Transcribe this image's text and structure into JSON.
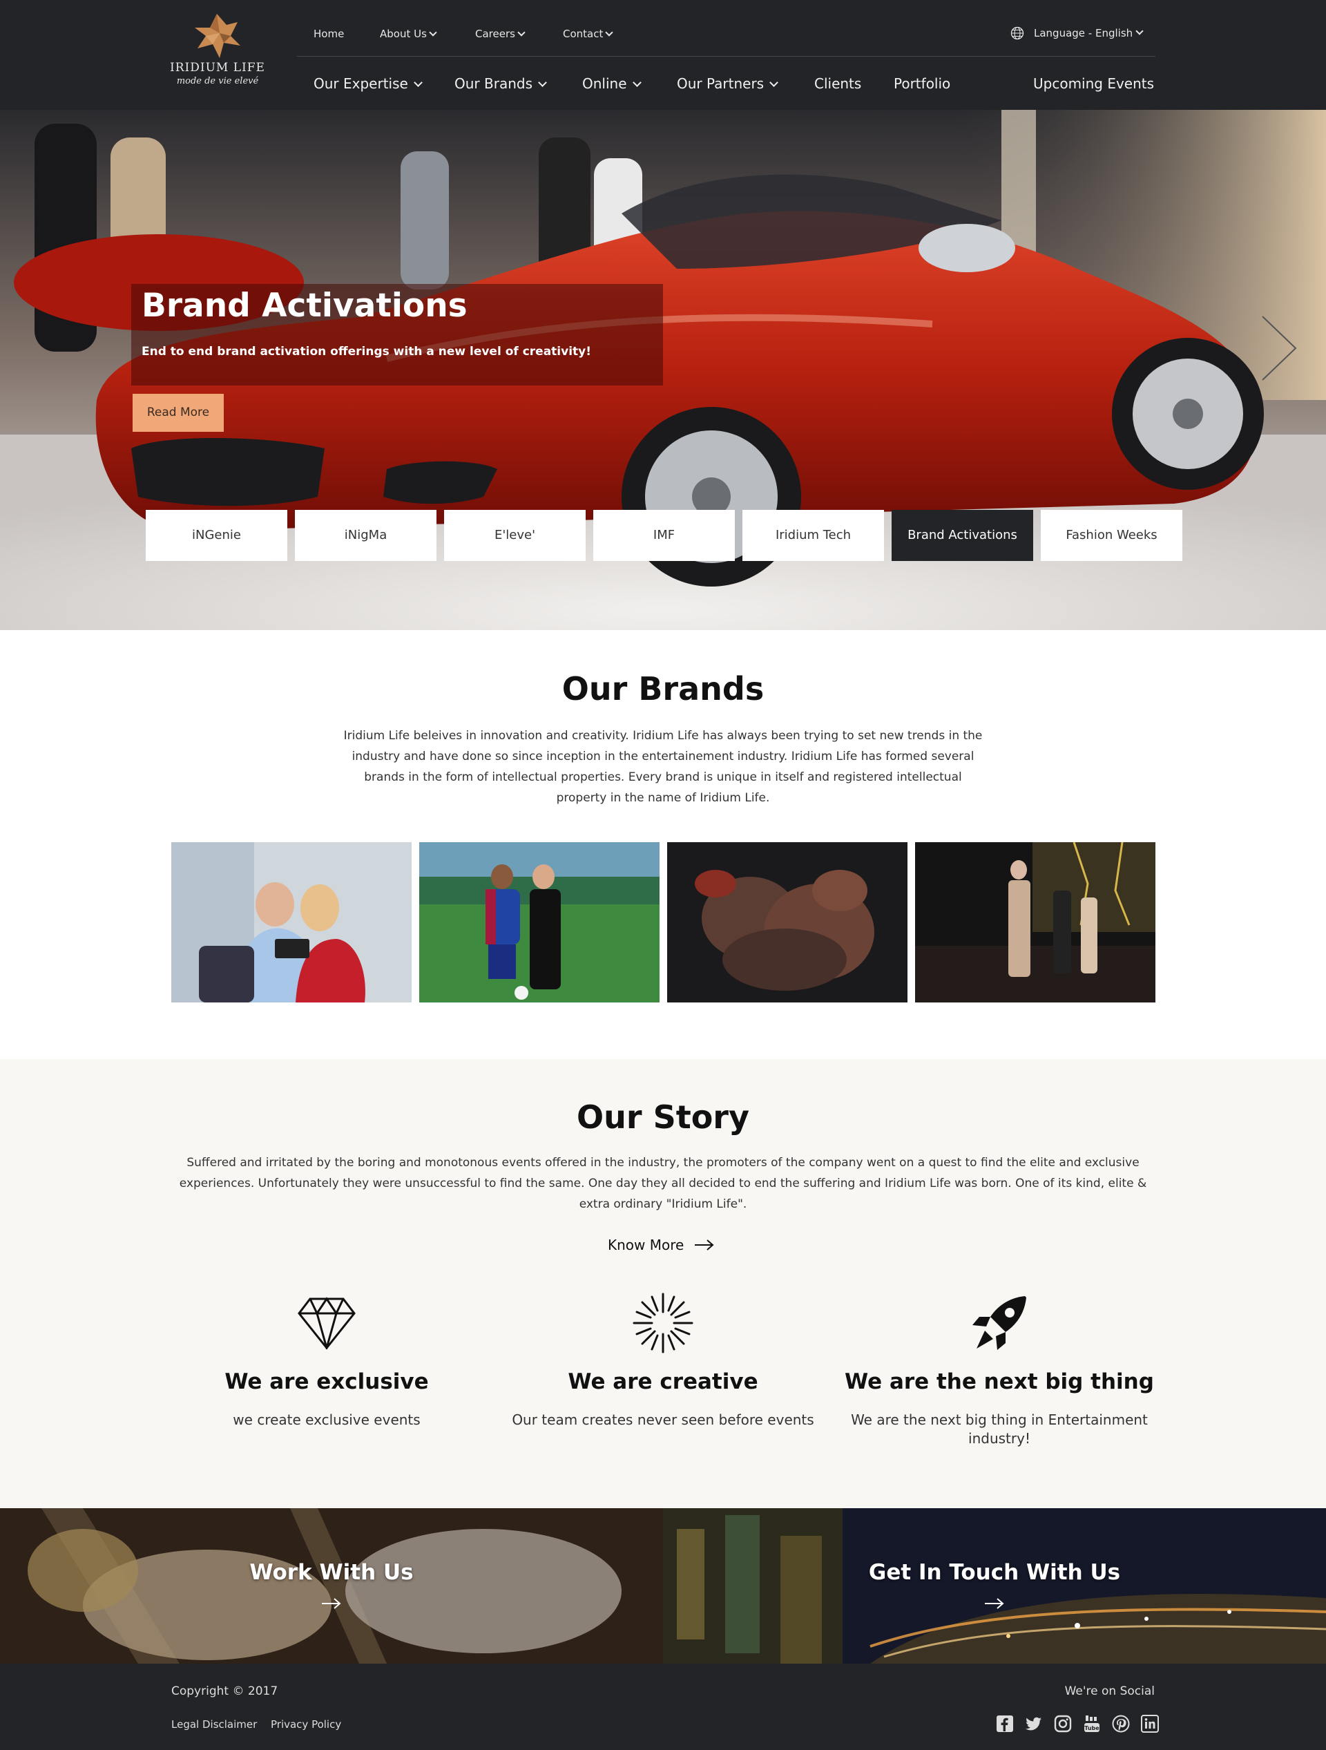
{
  "header": {
    "logo": {
      "name": "IRIDIUM LIFE",
      "tagline": "mode de vie elevé"
    },
    "top_nav": [
      {
        "label": "Home",
        "dropdown": false
      },
      {
        "label": "About Us",
        "dropdown": true
      },
      {
        "label": "Careers",
        "dropdown": true
      },
      {
        "label": "Contact",
        "dropdown": true
      }
    ],
    "language": "Language - English",
    "main_nav": [
      {
        "label": "Our Expertise",
        "dropdown": true
      },
      {
        "label": "Our Brands",
        "dropdown": true
      },
      {
        "label": "Online",
        "dropdown": true
      },
      {
        "label": "Our Partners",
        "dropdown": true
      },
      {
        "label": "Clients",
        "dropdown": false
      },
      {
        "label": "Portfolio",
        "dropdown": false
      },
      {
        "label": "Upcoming Events",
        "dropdown": false
      }
    ]
  },
  "hero": {
    "title": "Brand Activations",
    "subtitle": "End to end brand activation offerings with a new level of creativity!",
    "button": "Read More",
    "tabs": [
      "iNGenie",
      "iNigMa",
      "E'leve'",
      "IMF",
      "Iridium Tech",
      "Brand Activations",
      "Fashion Weeks"
    ],
    "active_tab": "Brand Activations"
  },
  "brands": {
    "title": "Our Brands",
    "text": "Iridium Life beleives in innovation and creativity. Iridium Life has always been trying to set new trends in the industry and have done so since inception in the entertainement industry. Iridium Life has formed several brands in the form of intellectual properties. Every brand is unique in itself and registered intellectual property in the name of Iridium Life."
  },
  "story": {
    "title": "Our Story",
    "text": "Suffered and irritated by the boring and monotonous events offered in the industry, the promoters of the company went on a quest to find the elite and exclusive experiences. Unfortunately they were unsuccessful to find the same. One day they all decided to end the suffering and Iridium Life was born. One of its kind, elite & extra ordinary \"Iridium Life\".",
    "know_more": "Know More",
    "features": [
      {
        "icon": "diamond-icon",
        "title": "We are exclusive",
        "text": "we create exclusive events"
      },
      {
        "icon": "burst-icon",
        "title": "We are creative",
        "text": "Our team creates never seen before events"
      },
      {
        "icon": "rocket-icon",
        "title": "We are the next big thing",
        "text": "We are the next big thing in Entertainment industry!"
      }
    ]
  },
  "cta": {
    "work": "Work With Us",
    "contact": "Get In Touch With Us"
  },
  "footer": {
    "copyright": "Copyright © 2017",
    "links": [
      "Legal Disclaimer",
      "Privacy Policy"
    ],
    "social_label": "We're on Social",
    "social": [
      "facebook-icon",
      "twitter-icon",
      "instagram-icon",
      "youtube-icon",
      "pinterest-icon",
      "linkedin-icon"
    ]
  },
  "colors": {
    "header_bg": "#232427",
    "accent": "#f1a878",
    "story_bg": "#f9f7f4"
  }
}
